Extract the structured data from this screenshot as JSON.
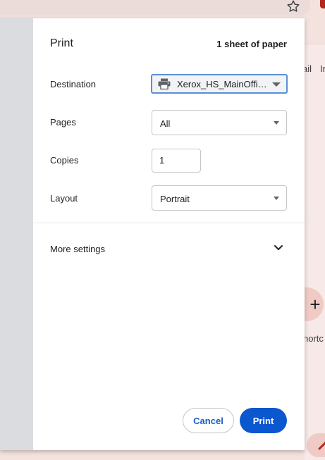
{
  "dialog": {
    "title": "Print",
    "sheet_count": "1 sheet of paper",
    "destination": {
      "label": "Destination",
      "value": "Xerox_HS_MainOffice",
      "icon": "printer-icon"
    },
    "pages": {
      "label": "Pages",
      "value": "All"
    },
    "copies": {
      "label": "Copies",
      "value": "1"
    },
    "layout": {
      "label": "Layout",
      "value": "Portrait"
    },
    "more_settings": {
      "label": "More settings",
      "icon": "chevron-down-icon"
    },
    "buttons": {
      "cancel": "Cancel",
      "print": "Print"
    }
  },
  "background": {
    "tab_text_1": "ail",
    "tab_text_2": "In",
    "add_shortcut_icon": "+",
    "shortcut_text": "hortc",
    "star_icon": "star-outline-icon"
  },
  "colors": {
    "accent": "#0b57d0",
    "focus_ring": "#5b8fd6",
    "preview_pane": "#dadce0",
    "page_background": "#f4e2df"
  }
}
